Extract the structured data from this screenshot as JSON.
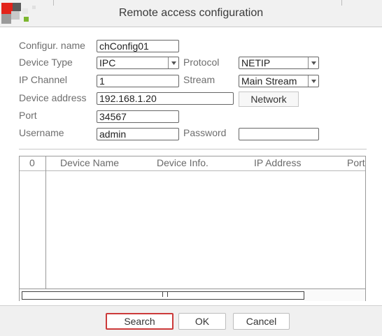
{
  "window": {
    "title": "Remote access configuration"
  },
  "form": {
    "config_name": {
      "label": "Configur. name",
      "value": "chConfig01"
    },
    "device_type": {
      "label": "Device Type",
      "value": "IPC"
    },
    "protocol": {
      "label": "Protocol",
      "value": "NETIP"
    },
    "ip_channel": {
      "label": "IP Channel",
      "value": "1"
    },
    "stream": {
      "label": "Stream",
      "value": "Main Stream"
    },
    "device_address": {
      "label": "Device address",
      "value": "192.168.1.20"
    },
    "network_button": "Network",
    "port": {
      "label": "Port",
      "value": "34567"
    },
    "username": {
      "label": "Username",
      "value": "admin"
    },
    "password": {
      "label": "Password",
      "value": ""
    }
  },
  "table": {
    "columns": [
      "0",
      "Device Name",
      "Device Info.",
      "IP Address",
      "Port"
    ],
    "rows": []
  },
  "footer": {
    "search": "Search",
    "ok": "OK",
    "cancel": "Cancel"
  },
  "colors": {
    "focus_border": "#cc3a3a",
    "logo_red": "#e2231a",
    "logo_green": "#7cb62f"
  }
}
